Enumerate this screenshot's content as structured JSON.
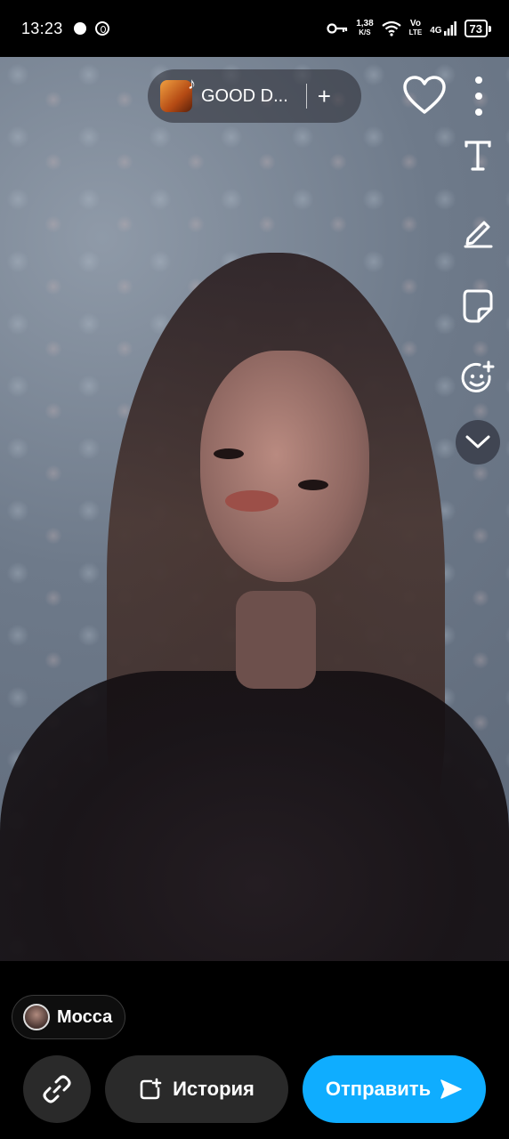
{
  "status_bar": {
    "time": "13:23",
    "speed": "1,38",
    "speed_unit": "K/S",
    "volte_top": "Vo",
    "volte_bottom": "LTE",
    "network": "4G",
    "battery": "73"
  },
  "music": {
    "title": "GOOD D...",
    "add_symbol": "+",
    "thumb_icon": "music-note-icon"
  },
  "top_actions": {
    "like_icon": "heart-icon",
    "more_icon": "more-vertical-icon"
  },
  "tools": [
    {
      "name": "text-tool",
      "icon": "text-icon"
    },
    {
      "name": "draw-tool",
      "icon": "pencil-icon"
    },
    {
      "name": "sticker-tool",
      "icon": "sticker-icon"
    },
    {
      "name": "emoji-tool",
      "icon": "smiley-sparkle-icon"
    },
    {
      "name": "expand-tools",
      "icon": "chevron-down-icon"
    }
  ],
  "bottom": {
    "location_label": "Мосса",
    "story_label": "История",
    "send_label": "Отправить",
    "send_color": "#0fadff"
  }
}
